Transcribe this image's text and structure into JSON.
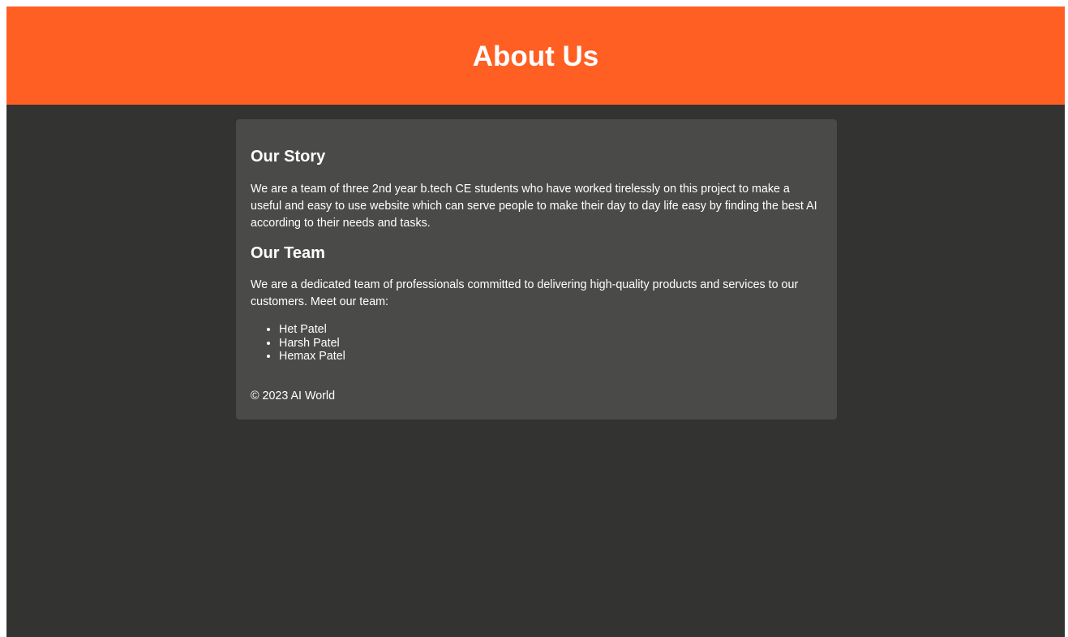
{
  "header": {
    "title": "About Us"
  },
  "story": {
    "heading": "Our Story",
    "text": "We are a team of three 2nd year b.tech CE students who have worked tirelessly on this project to make a useful and easy to use website which can serve people to make their day to day life easy by finding the best AI according to their needs and tasks."
  },
  "team": {
    "heading": "Our Team",
    "text": "We are a dedicated team of professionals committed to delivering high-quality products and services to our customers. Meet our team:",
    "members": [
      "Het Patel",
      "Harsh Patel",
      "Hemax Patel"
    ]
  },
  "footer": {
    "text": "© 2023 AI World"
  },
  "colors": {
    "header_bg": "#ff5f22",
    "page_bg": "#333432",
    "card_bg": "#4a4b48",
    "text": "#ffffff"
  }
}
